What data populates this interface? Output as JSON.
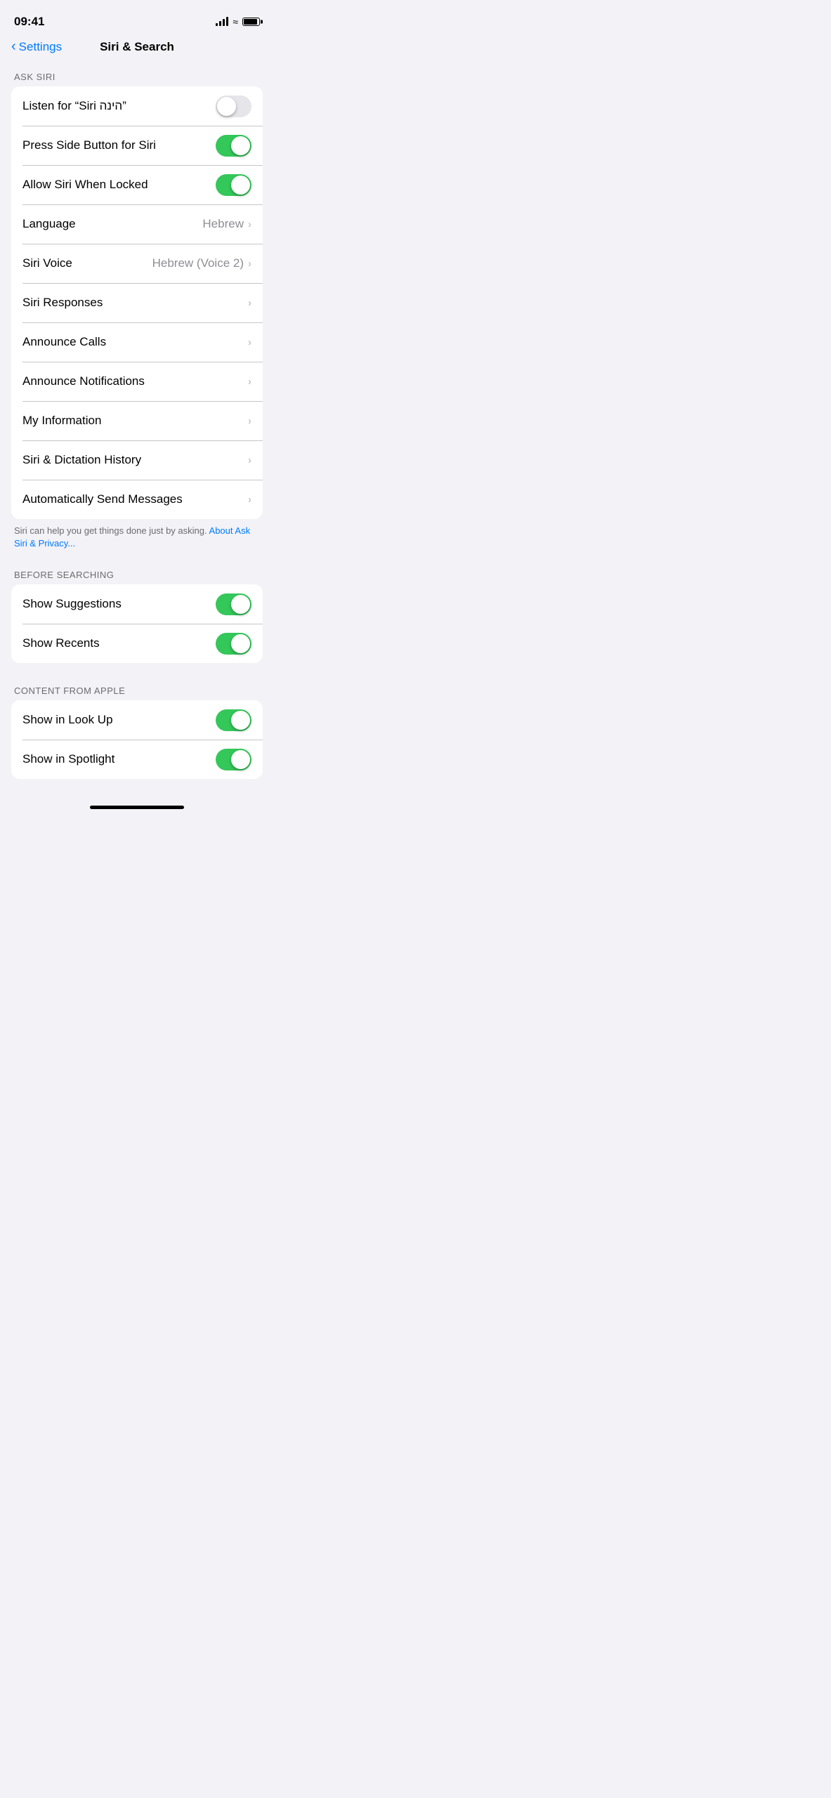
{
  "statusBar": {
    "time": "09:41"
  },
  "navBar": {
    "backLabel": "Settings",
    "title": "Siri & Search"
  },
  "sections": [
    {
      "id": "ask-siri",
      "header": "ASK SIRI",
      "rows": [
        {
          "id": "listen-siri",
          "label": "Listen for “Siri הינה”",
          "type": "toggle",
          "value": false
        },
        {
          "id": "press-side",
          "label": "Press Side Button for Siri",
          "type": "toggle",
          "value": true
        },
        {
          "id": "allow-locked",
          "label": "Allow Siri When Locked",
          "type": "toggle",
          "value": true
        },
        {
          "id": "language",
          "label": "Language",
          "type": "nav",
          "value": "Hebrew"
        },
        {
          "id": "siri-voice",
          "label": "Siri Voice",
          "type": "nav",
          "value": "Hebrew (Voice 2)"
        },
        {
          "id": "siri-responses",
          "label": "Siri Responses",
          "type": "nav",
          "value": ""
        },
        {
          "id": "announce-calls",
          "label": "Announce Calls",
          "type": "nav",
          "value": ""
        },
        {
          "id": "announce-notifications",
          "label": "Announce Notifications",
          "type": "nav",
          "value": ""
        },
        {
          "id": "my-information",
          "label": "My Information",
          "type": "nav",
          "value": ""
        },
        {
          "id": "siri-dictation-history",
          "label": "Siri & Dictation History",
          "type": "nav",
          "value": ""
        },
        {
          "id": "auto-send-messages",
          "label": "Automatically Send Messages",
          "type": "nav",
          "value": ""
        }
      ],
      "footer": "Siri can help you get things done just by asking.",
      "footerLink": "About Ask Siri & Privacy..."
    },
    {
      "id": "before-searching",
      "header": "BEFORE SEARCHING",
      "rows": [
        {
          "id": "show-suggestions",
          "label": "Show Suggestions",
          "type": "toggle",
          "value": true
        },
        {
          "id": "show-recents",
          "label": "Show Recents",
          "type": "toggle",
          "value": true
        }
      ],
      "footer": "",
      "footerLink": ""
    },
    {
      "id": "content-from-apple",
      "header": "CONTENT FROM APPLE",
      "rows": [
        {
          "id": "show-in-look-up",
          "label": "Show in Look Up",
          "type": "toggle",
          "value": true
        },
        {
          "id": "show-in-spotlight",
          "label": "Show in Spotlight",
          "type": "toggle",
          "value": true
        }
      ],
      "footer": "",
      "footerLink": ""
    }
  ]
}
